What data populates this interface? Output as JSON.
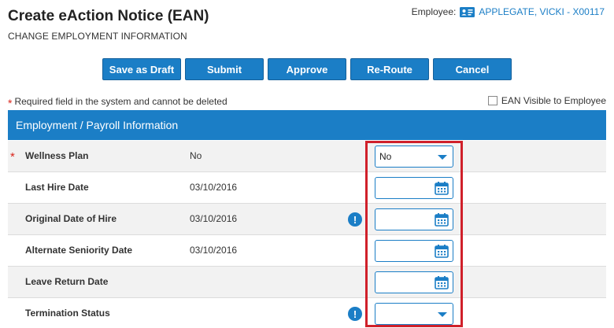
{
  "header": {
    "title": "Create eAction Notice (EAN)",
    "subtitle": "CHANGE EMPLOYMENT INFORMATION",
    "employee_label": "Employee:",
    "employee_name": "APPLEGATE, VICKI - X00117"
  },
  "toolbar": {
    "buttons": [
      {
        "label": "Save as Draft"
      },
      {
        "label": "Submit"
      },
      {
        "label": "Approve"
      },
      {
        "label": "Re-Route"
      },
      {
        "label": "Cancel"
      }
    ]
  },
  "required_note": "Required field in the system and cannot be deleted",
  "visible_checkbox": {
    "label": "EAN Visible to Employee",
    "checked": false
  },
  "section": {
    "title": "Employment / Payroll Information"
  },
  "fields": [
    {
      "label": "Wellness Plan",
      "required": true,
      "value": "No",
      "alert": false,
      "control": "select",
      "control_value": "No"
    },
    {
      "label": "Last Hire Date",
      "required": false,
      "value": "03/10/2016",
      "alert": false,
      "control": "date",
      "control_value": ""
    },
    {
      "label": "Original Date of Hire",
      "required": false,
      "value": "03/10/2016",
      "alert": true,
      "control": "date",
      "control_value": ""
    },
    {
      "label": "Alternate Seniority Date",
      "required": false,
      "value": "03/10/2016",
      "alert": false,
      "control": "date",
      "control_value": ""
    },
    {
      "label": "Leave Return Date",
      "required": false,
      "value": "",
      "alert": false,
      "control": "date",
      "control_value": ""
    },
    {
      "label": "Termination Status",
      "required": false,
      "value": "",
      "alert": true,
      "control": "select",
      "control_value": ""
    }
  ],
  "colors": {
    "accent": "#1b7ec6",
    "required": "#d9251c",
    "highlight": "#d0202a",
    "alt_row": "#f2f2f2"
  },
  "icons": {
    "employee": "id-card-icon",
    "calendar": "calendar-icon",
    "alert": "exclamation-icon",
    "dropdown": "caret-down-icon"
  }
}
